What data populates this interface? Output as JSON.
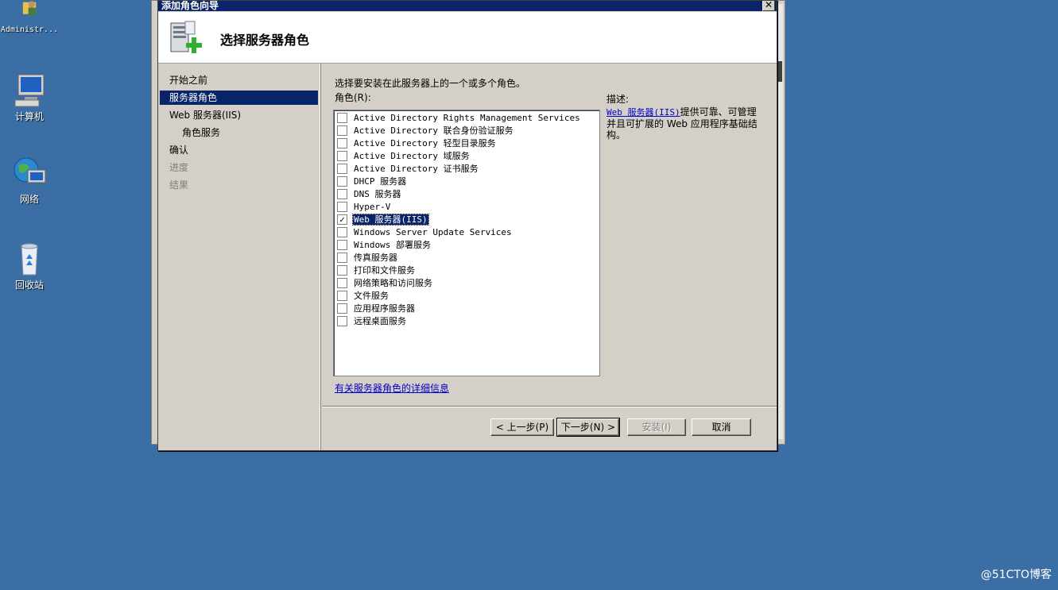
{
  "desktop": {
    "icons": [
      {
        "label": "Administr..."
      },
      {
        "label": "计算机"
      },
      {
        "label": "网络"
      },
      {
        "label": "回收站"
      }
    ]
  },
  "dialog": {
    "title": "添加角色向导",
    "close_glyph": "✕",
    "header_title": "选择服务器角色"
  },
  "nav": {
    "items": [
      {
        "label": "开始之前"
      },
      {
        "label": "服务器角色"
      },
      {
        "label": "Web 服务器(IIS)"
      },
      {
        "label": "角色服务"
      },
      {
        "label": "确认"
      },
      {
        "label": "进度"
      },
      {
        "label": "结果"
      }
    ]
  },
  "content": {
    "instruction": "选择要安装在此服务器上的一个或多个角色。",
    "roles_label": "角色(R):",
    "roles": [
      {
        "label": "Active Directory Rights Management Services",
        "checked": false
      },
      {
        "label": "Active Directory 联合身份验证服务",
        "checked": false
      },
      {
        "label": "Active Directory 轻型目录服务",
        "checked": false
      },
      {
        "label": "Active Directory 域服务",
        "checked": false
      },
      {
        "label": "Active Directory 证书服务",
        "checked": false
      },
      {
        "label": "DHCP 服务器",
        "checked": false
      },
      {
        "label": "DNS 服务器",
        "checked": false
      },
      {
        "label": "Hyper-V",
        "checked": false
      },
      {
        "label": "Web 服务器(IIS)",
        "checked": true
      },
      {
        "label": "Windows Server Update Services",
        "checked": false
      },
      {
        "label": "Windows 部署服务",
        "checked": false
      },
      {
        "label": "传真服务器",
        "checked": false
      },
      {
        "label": "打印和文件服务",
        "checked": false
      },
      {
        "label": "网络策略和访问服务",
        "checked": false
      },
      {
        "label": "文件服务",
        "checked": false
      },
      {
        "label": "应用程序服务器",
        "checked": false
      },
      {
        "label": "远程桌面服务",
        "checked": false
      }
    ],
    "more_info_link": "有关服务器角色的详细信息",
    "description_label": "描述:",
    "description_link": "Web 服务器(IIS)",
    "description_text": "提供可靠、可管理并且可扩展的 Web 应用程序基础结构。"
  },
  "buttons": {
    "prev": "< 上一步(P)",
    "next": "下一步(N) >",
    "install": "安装(I)",
    "cancel": "取消"
  },
  "watermark": "@51CTO博客"
}
